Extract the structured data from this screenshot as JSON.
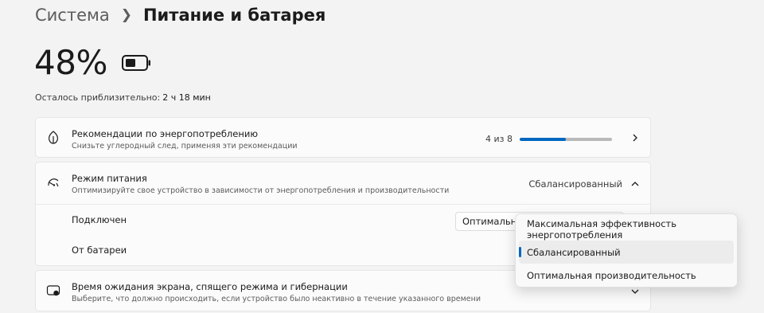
{
  "breadcrumb": {
    "parent": "Система",
    "current": "Питание и батарея"
  },
  "battery": {
    "percent": "48%",
    "icon": "battery-icon",
    "remaining_label": "Осталось приблизительно:",
    "remaining_value": "2 ч 18 мин"
  },
  "recommendations": {
    "icon": "leaf-icon",
    "title": "Рекомендации по энергопотреблению",
    "subtitle": "Снизьте углеродный след, применяя эти рекомендации",
    "progress_text": "4 из 8",
    "progress_fraction": 0.5
  },
  "power_mode": {
    "icon": "power-mode-icon",
    "title": "Режим питания",
    "subtitle": "Оптимизируйте свое устройство в зависимости от энергопотребления и производительности",
    "value": "Сбалансированный",
    "plugged_label": "Подключен",
    "plugged_value": "Оптимальная производительность",
    "battery_label": "От батареи"
  },
  "sleep": {
    "icon": "screen-sleep-icon",
    "title": "Время ожидания экрана, спящего режима и гибернации",
    "subtitle": "Выберите, что должно происходить, если устройство было неактивно в течение указанного времени"
  },
  "dropdown": {
    "options": [
      "Максимальная эффективность энергопотребления",
      "Сбалансированный",
      "Оптимальная производительность"
    ],
    "selected_index": 1
  },
  "colors": {
    "accent": "#0067c0",
    "background": "#f3f3f3",
    "card": "#fbfbfb"
  }
}
